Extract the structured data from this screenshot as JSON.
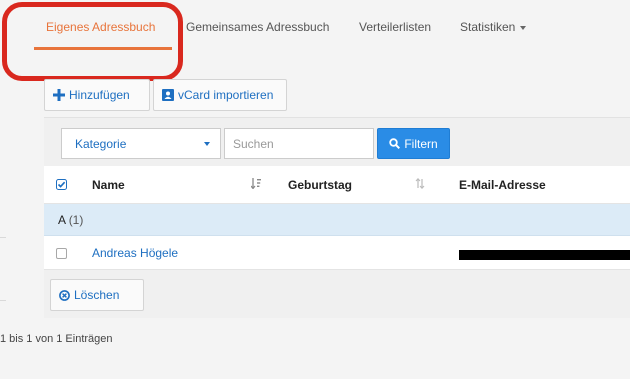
{
  "tabs": [
    {
      "label": "Eigenes Adressbuch",
      "active": true
    },
    {
      "label": "Gemeinsames Adressbuch",
      "active": false
    },
    {
      "label": "Verteilerlisten",
      "active": false
    },
    {
      "label": "Statistiken",
      "active": false,
      "dropdown": true
    }
  ],
  "toolbar": {
    "add_label": "Hinzufügen",
    "vcard_label": "vCard importieren"
  },
  "filter": {
    "category_selected": "Kategorie",
    "search_placeholder": "Suchen",
    "filter_label": "Filtern"
  },
  "table": {
    "columns": [
      "Name",
      "Geburtstag",
      "E-Mail-Adresse"
    ],
    "groups": [
      {
        "letter": "A",
        "count": "(1)",
        "rows": [
          {
            "name": "Andreas Högele",
            "birthday": "",
            "email_redacted": true
          }
        ]
      }
    ],
    "delete_label": "Löschen"
  },
  "pagination": {
    "info": "1 bis 1 von 1 Einträgen"
  },
  "colors": {
    "accent": "#e8743b",
    "link": "#1e6fc1",
    "primary": "#2a8ce6",
    "highlight": "#d9281e",
    "group_row": "#dcebf7"
  },
  "icons": [
    "plus-icon",
    "contact-card-icon",
    "search-icon",
    "check-all-icon",
    "sort-alpha-icon",
    "sort-icon",
    "delete-circle-icon",
    "chevron-down-icon"
  ]
}
